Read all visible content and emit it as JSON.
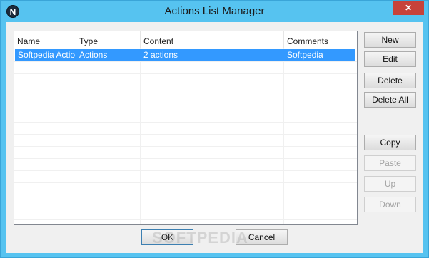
{
  "window": {
    "title": "Actions List Manager",
    "icon_letter": "N",
    "close_glyph": "✕"
  },
  "list": {
    "columns": [
      "Name",
      "Type",
      "Content",
      "Comments"
    ],
    "rows": [
      [
        "Softpedia Actio...",
        "Actions",
        "2 actions",
        "Softpedia"
      ]
    ]
  },
  "buttons": {
    "new": "New",
    "edit": "Edit",
    "delete": "Delete",
    "delete_all": "Delete All",
    "copy": "Copy",
    "paste": "Paste",
    "up": "Up",
    "down": "Down",
    "ok": "OK",
    "cancel": "Cancel"
  },
  "watermark": "SOFTPEDIA",
  "colors": {
    "title_bar": "#56c3f0",
    "selection": "#3399ff",
    "close_button": "#c7423a"
  }
}
